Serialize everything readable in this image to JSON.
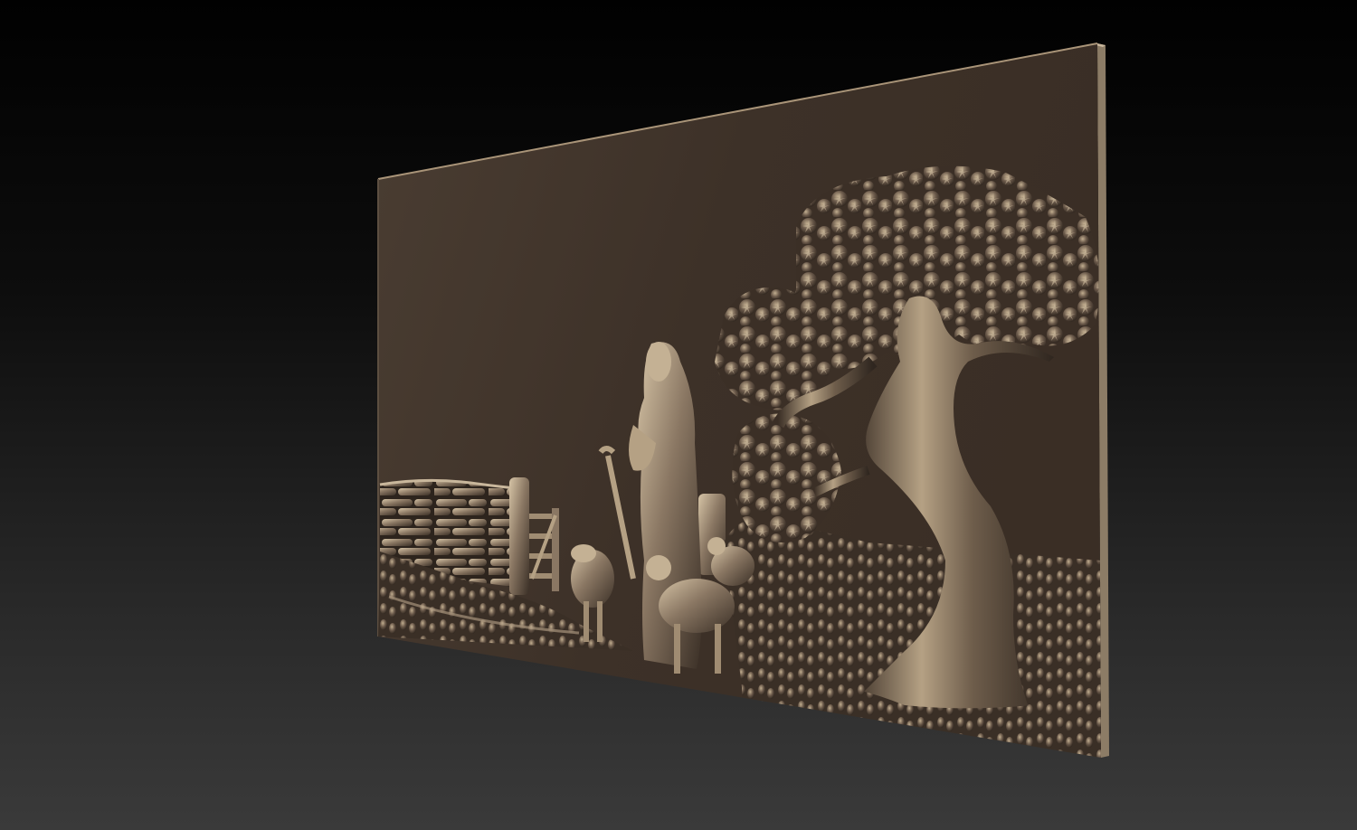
{
  "scene": {
    "subject": "relief-panel",
    "colors": {
      "background_top": "#010101",
      "background_bottom": "#3a3a3a",
      "panel_face": "#3d3128",
      "panel_highlight": "#b8a488",
      "panel_edge": "#8c7c66",
      "relief_dark": "#2a211b",
      "relief_mid": "#6e5d4b",
      "relief_light": "#c9b79c"
    }
  }
}
